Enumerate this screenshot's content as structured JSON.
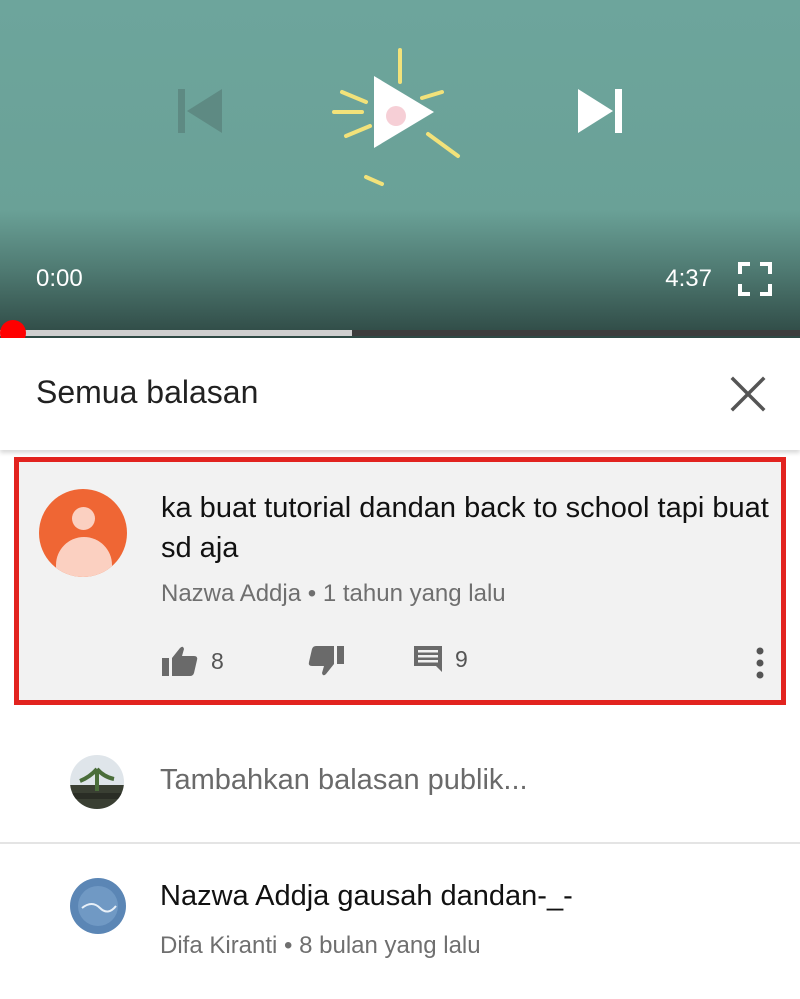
{
  "player": {
    "time_current": "0:00",
    "time_total": "4:37",
    "progress": 0.0,
    "buffered": 0.44
  },
  "replies": {
    "title": "Semua balasan"
  },
  "comment": {
    "text": "ka buat tutorial dandan back to school tapi buat sd aja",
    "author": "Nazwa Addja",
    "time": "1 tahun yang lalu",
    "likes": "8",
    "replies": "9"
  },
  "add_reply": {
    "placeholder": "Tambahkan balasan publik..."
  },
  "reply": {
    "text": "Nazwa Addja gausah dandan-_-",
    "author": "Difa Kiranti",
    "time": "8 bulan yang lalu"
  },
  "colors": {
    "player_bg": "#6aa197",
    "highlight_border": "#e2231f",
    "avatar_orange": "#ef6634",
    "scrubber": "#ff0000"
  },
  "icons": {
    "prev": "skip-previous-icon",
    "play": "play-icon",
    "next": "skip-next-icon",
    "fullscreen": "fullscreen-icon",
    "close": "close-icon",
    "like": "thumbs-up-icon",
    "dislike": "thumbs-down-icon",
    "reply": "comment-icon",
    "more": "more-vertical-icon"
  }
}
